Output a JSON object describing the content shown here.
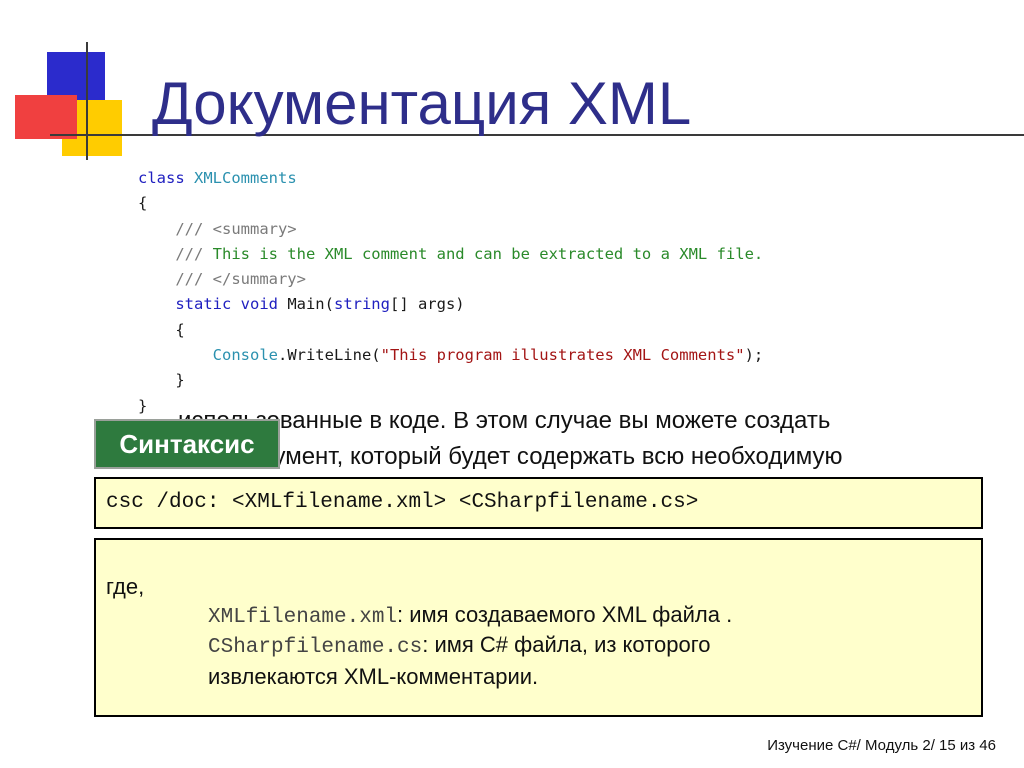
{
  "title": "Документация XML",
  "background_text": {
    "fragment_right": "ко",
    "line1": "использованные в коде. В этом случае вы можете создать",
    "line2": "XML-документ, который будет содержать всю необходимую"
  },
  "code": {
    "lines": [
      [
        {
          "t": "class ",
          "c": "kw"
        },
        {
          "t": "XMLComments",
          "c": "ty"
        }
      ],
      [
        {
          "t": "{",
          "c": ""
        }
      ],
      [
        {
          "t": "    /// ",
          "c": "tg"
        },
        {
          "t": "<summary>",
          "c": "tg"
        }
      ],
      [
        {
          "t": "    /// ",
          "c": "tg"
        },
        {
          "t": "This is the XML comment and can be extracted to a XML file.",
          "c": "cm"
        }
      ],
      [
        {
          "t": "    /// ",
          "c": "tg"
        },
        {
          "t": "</summary>",
          "c": "tg"
        }
      ],
      [
        {
          "t": "    static void ",
          "c": "kw"
        },
        {
          "t": "Main(",
          "c": ""
        },
        {
          "t": "string",
          "c": "kw"
        },
        {
          "t": "[] args)",
          "c": ""
        }
      ],
      [
        {
          "t": "    {",
          "c": ""
        }
      ],
      [
        {
          "t": "        ",
          "c": ""
        },
        {
          "t": "Console",
          "c": "ty"
        },
        {
          "t": ".WriteLine(",
          "c": ""
        },
        {
          "t": "\"This program illustrates XML Comments\"",
          "c": "st"
        },
        {
          "t": ");",
          "c": ""
        }
      ],
      [
        {
          "t": "    }",
          "c": ""
        }
      ],
      [
        {
          "t": "}",
          "c": ""
        }
      ]
    ]
  },
  "syntax": {
    "label": "Синтаксис",
    "command": "csc /doc: <XMLfilename.xml> <CSharpfilename.cs>"
  },
  "explanation": {
    "where": "где,",
    "param1_code": "XMLfilename.xml",
    "param1_text": ": имя создаваемого XML файла  .",
    "param2_code": "CSharpfilename.cs",
    "param2_text": ": имя C# файла, из которого",
    "param3_text": "извлекаются XML-комментарии."
  },
  "footer": "Изучение C#/ Модуль 2/ 15 из 46",
  "colors": {
    "title": "#2e2e8a",
    "syntax_label_bg": "#2e7a3e",
    "box_bg": "#ffffcc"
  }
}
